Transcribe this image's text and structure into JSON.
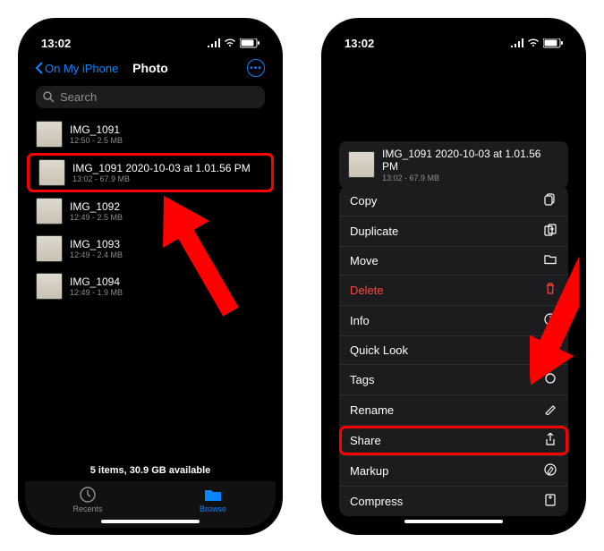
{
  "status": {
    "time": "13:02"
  },
  "nav": {
    "back": "On My iPhone",
    "title": "Photo"
  },
  "search": {
    "placeholder": "Search"
  },
  "files": [
    {
      "name": "IMG_1091",
      "meta": "12:50 - 2.5 MB"
    },
    {
      "name": "IMG_1091 2020-10-03 at 1.01.56 PM",
      "meta": "13:02 - 67.9 MB"
    },
    {
      "name": "IMG_1092",
      "meta": "12:49 - 2.5 MB"
    },
    {
      "name": "IMG_1093",
      "meta": "12:49 - 2.4 MB"
    },
    {
      "name": "IMG_1094",
      "meta": "12:49 - 1.9 MB"
    }
  ],
  "footer": {
    "info": "5 items, 30.9 GB available",
    "recents": "Recents",
    "browse": "Browse"
  },
  "preview": {
    "name": "IMG_1091 2020-10-03 at 1.01.56 PM",
    "meta": "13:02 - 67.9 MB"
  },
  "menu": {
    "copy": "Copy",
    "duplicate": "Duplicate",
    "move": "Move",
    "delete": "Delete",
    "info": "Info",
    "quicklook": "Quick Look",
    "tags": "Tags",
    "rename": "Rename",
    "share": "Share",
    "markup": "Markup",
    "compress": "Compress"
  }
}
